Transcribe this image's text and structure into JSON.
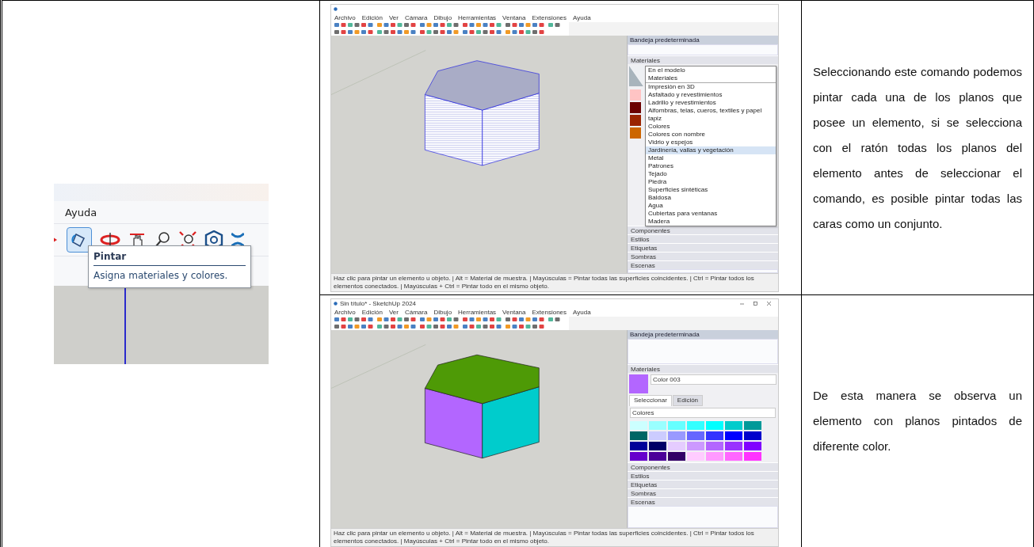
{
  "tooltip_shot": {
    "menu_label": "Ayuda",
    "tooltip": {
      "title": "Pintar",
      "text": "Asigna materiales y colores."
    }
  },
  "rows": [
    {
      "description": "Seleccionando este comando podemos pintar cada una de los planos que posee un elemento, si se selecciona con el ratón todas los planos del elemento antes de seleccionar el comando, es posible pintar todas las caras como un conjunto.",
      "screenshot": {
        "kind": "dropdown",
        "menu": [
          "Archivo",
          "Edición",
          "Ver",
          "Cámara",
          "Dibujo",
          "Herramientas",
          "Ventana",
          "Extensiones",
          "Ayuda"
        ],
        "faces": [
          {
            "color": "#a9acc6"
          }
        ],
        "panel": {
          "title": "Bandeja predeterminada",
          "materials_label": "Materiales",
          "library_items": [
            {
              "label": "En el modelo",
              "selected": false
            },
            {
              "label": "Materiales",
              "selected": false
            },
            {
              "label": "Impresión en 3D",
              "selected": false
            },
            {
              "label": "Asfaltado y revestimientos",
              "selected": false
            },
            {
              "label": "Ladrillo y revestimientos",
              "selected": false
            },
            {
              "label": "Alfombras, telas, cueros, textiles y papel tapiz",
              "selected": false
            },
            {
              "label": "Colores",
              "selected": false
            },
            {
              "label": "Colores con nombre",
              "selected": false
            },
            {
              "label": "Vidrio y espejos",
              "selected": false
            },
            {
              "label": "Jardinería, vallas y vegetación",
              "selected": true
            },
            {
              "label": "Metal",
              "selected": false
            },
            {
              "label": "Patrones",
              "selected": false
            },
            {
              "label": "Tejado",
              "selected": false
            },
            {
              "label": "Piedra",
              "selected": false
            },
            {
              "label": "Superficies sintéticas",
              "selected": false
            },
            {
              "label": "Baldosa",
              "selected": false
            },
            {
              "label": "Agua",
              "selected": false
            },
            {
              "label": "Cubiertas para ventanas",
              "selected": false
            },
            {
              "label": "Madera",
              "selected": false
            }
          ],
          "swatches": [
            {
              "color": "#ffc4c4"
            },
            {
              "color": "#6b0000"
            },
            {
              "color": "#9a2400"
            },
            {
              "color": "#cc6600"
            }
          ],
          "sections": [
            "Componentes",
            "Estilos",
            "Etiquetas",
            "Sombras",
            "Escenas"
          ]
        },
        "status_text": "Haz clic para pintar un elemento u objeto. | Alt = Material de muestra. | Mayúsculas = Pintar todas las superficies coincidentes. | Ctrl = Pintar todos los elementos conectados. | Mayúsculas + Ctrl = Pintar todo en el mismo objeto."
      }
    },
    {
      "description": "De esta manera se observa un elemento con planos pintados de diferente color.",
      "screenshot": {
        "kind": "palette",
        "title": "Sin título* - SketchUp 2024",
        "menu": [
          "Archivo",
          "Edición",
          "Ver",
          "Cámara",
          "Dibujo",
          "Herramientas",
          "Ventana",
          "Extensiones",
          "Ayuda"
        ],
        "faces": [
          {
            "color": "#4e9a06"
          },
          {
            "color": "#b366ff"
          },
          {
            "color": "#00cccc"
          }
        ],
        "panel": {
          "title": "Bandeja predeterminada",
          "materials_label": "Materiales",
          "material_name": "Color 003",
          "material_preview": {
            "color": "#b366ff"
          },
          "tabs": [
            {
              "label": "Seleccionar",
              "selected": true
            },
            {
              "label": "Edición",
              "selected": false
            }
          ],
          "library": "Colores",
          "swatches": [
            {
              "color": "#ccffff"
            },
            {
              "color": "#99ffff"
            },
            {
              "color": "#66ffff"
            },
            {
              "color": "#33ffff"
            },
            {
              "color": "#00ffff"
            },
            {
              "color": "#00cccc"
            },
            {
              "color": "#009999"
            },
            {
              "color": "#006666"
            },
            {
              "color": "#ccccff"
            },
            {
              "color": "#9999ff"
            },
            {
              "color": "#6666ff"
            },
            {
              "color": "#3333ff"
            },
            {
              "color": "#0000ff"
            },
            {
              "color": "#0000cc"
            },
            {
              "color": "#000099"
            },
            {
              "color": "#000066"
            },
            {
              "color": "#e5ccff"
            },
            {
              "color": "#cc99ff"
            },
            {
              "color": "#b366ff"
            },
            {
              "color": "#9933ff"
            },
            {
              "color": "#8000ff"
            },
            {
              "color": "#6600cc"
            },
            {
              "color": "#4c0099"
            },
            {
              "color": "#330066"
            },
            {
              "color": "#ffccff"
            },
            {
              "color": "#ff99ff"
            },
            {
              "color": "#ff66ff"
            },
            {
              "color": "#ff33ff"
            }
          ],
          "sections": [
            "Componentes",
            "Estilos",
            "Etiquetas",
            "Sombras",
            "Escenas"
          ]
        },
        "status_text": "Haz clic para pintar un elemento u objeto. | Alt = Material de muestra. | Mayúsculas = Pintar todas las superficies coincidentes. | Ctrl = Pintar todos los elementos conectados. | Mayúsculas + Ctrl = Pintar todo en el mismo objeto."
      }
    }
  ]
}
